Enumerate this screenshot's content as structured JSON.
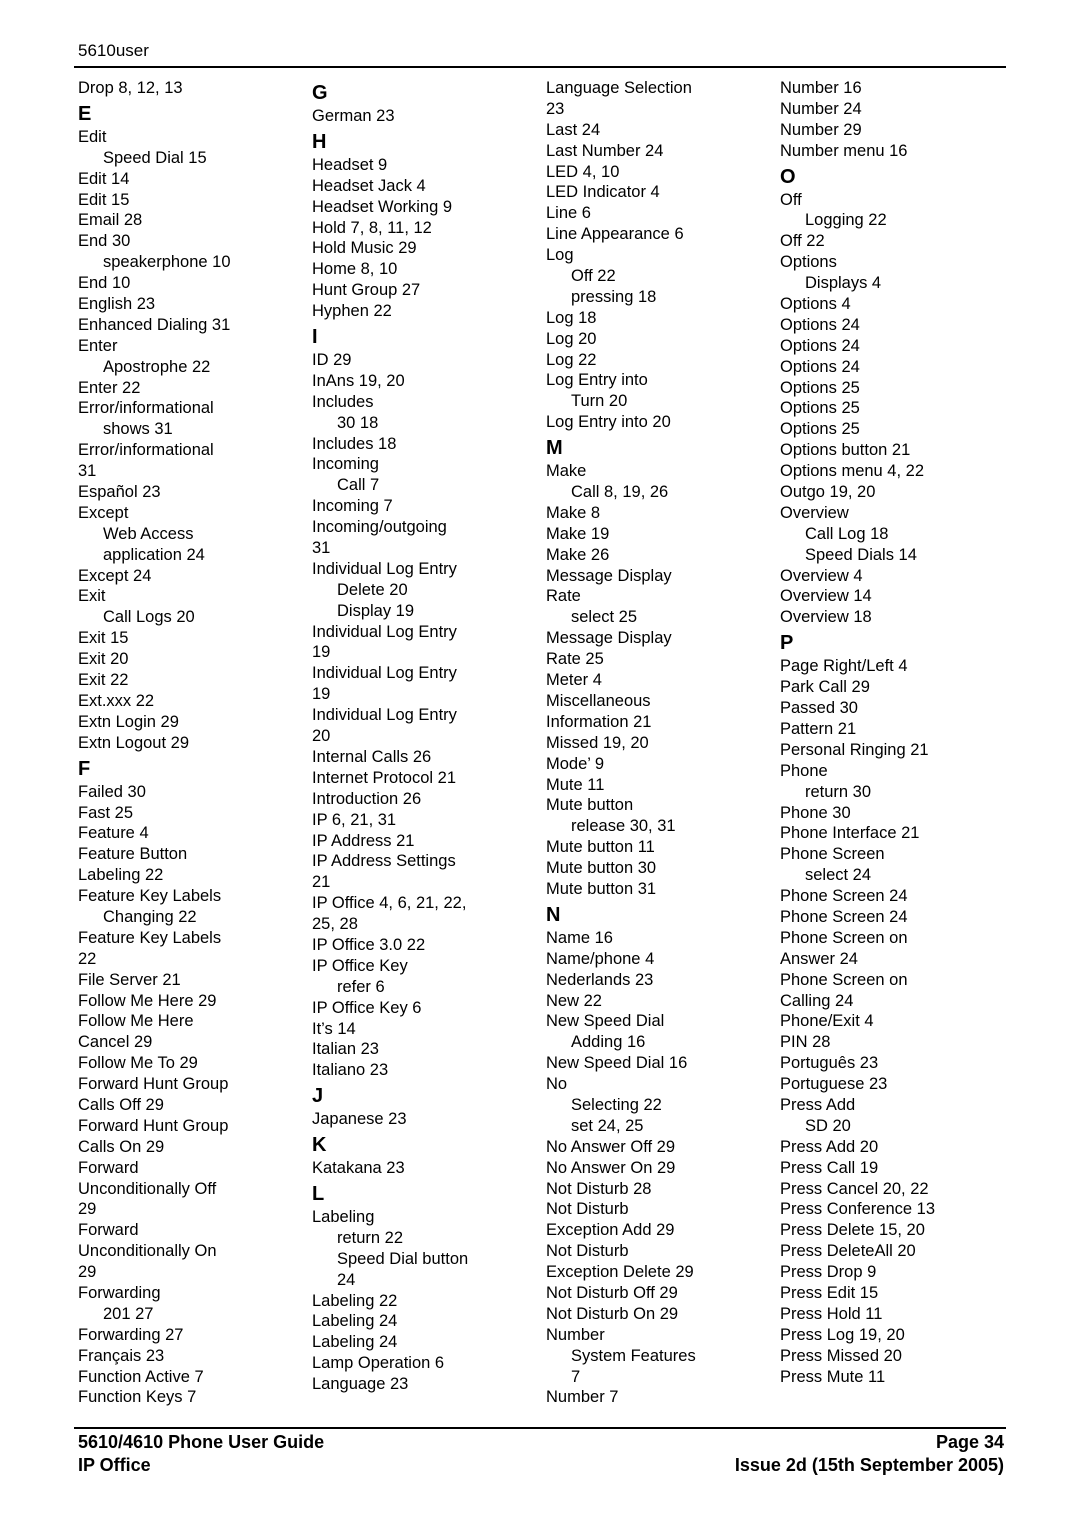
{
  "header": {
    "title": "5610user"
  },
  "columns": [
    [
      {
        "t": "Drop 8, 12, 13"
      },
      {
        "h": "E"
      },
      {
        "t": "Edit"
      },
      {
        "t": "Speed Dial 15",
        "s": 1
      },
      {
        "t": "Edit 14"
      },
      {
        "t": "Edit 15"
      },
      {
        "t": "Email 28"
      },
      {
        "t": "End 30"
      },
      {
        "t": "speakerphone 10",
        "s": 1
      },
      {
        "t": "End 10"
      },
      {
        "t": "English 23"
      },
      {
        "t": "Enhanced Dialing 31"
      },
      {
        "t": "Enter"
      },
      {
        "t": "Apostrophe 22",
        "s": 1
      },
      {
        "t": "Enter 22"
      },
      {
        "t": "Error/informational"
      },
      {
        "t": "shows 31",
        "s": 1
      },
      {
        "t": "Error/informational"
      },
      {
        "t": "31"
      },
      {
        "t": "Español 23"
      },
      {
        "t": "Except"
      },
      {
        "t": "Web Access",
        "s": 1
      },
      {
        "t": "application 24",
        "s": 1
      },
      {
        "t": "Except 24"
      },
      {
        "t": "Exit"
      },
      {
        "t": "Call Logs 20",
        "s": 1
      },
      {
        "t": "Exit 15"
      },
      {
        "t": "Exit 20"
      },
      {
        "t": "Exit 22"
      },
      {
        "t": "Ext.xxx 22"
      },
      {
        "t": "Extn Login 29"
      },
      {
        "t": "Extn Logout 29"
      },
      {
        "h": "F"
      },
      {
        "t": "Failed 30"
      },
      {
        "t": "Fast 25"
      },
      {
        "t": "Feature 4"
      },
      {
        "t": "Feature Button"
      },
      {
        "t": "Labeling 22"
      },
      {
        "t": "Feature Key Labels"
      },
      {
        "t": "Changing 22",
        "s": 1
      },
      {
        "t": "Feature Key Labels"
      },
      {
        "t": "22"
      },
      {
        "t": "File Server 21"
      },
      {
        "t": "Follow Me Here 29"
      },
      {
        "t": "Follow Me Here"
      },
      {
        "t": "Cancel 29"
      },
      {
        "t": "Follow Me To 29"
      },
      {
        "t": "Forward Hunt Group"
      },
      {
        "t": "Calls Off 29"
      },
      {
        "t": "Forward Hunt Group"
      },
      {
        "t": "Calls On 29"
      },
      {
        "t": "Forward"
      },
      {
        "t": "Unconditionally Off"
      },
      {
        "t": "29"
      },
      {
        "t": "Forward"
      },
      {
        "t": "Unconditionally On"
      },
      {
        "t": "29"
      },
      {
        "t": "Forwarding"
      },
      {
        "t": "201 27",
        "s": 1
      },
      {
        "t": "Forwarding 27"
      },
      {
        "t": "Français 23"
      },
      {
        "t": "Function Active 7"
      },
      {
        "t": "Function Keys 7"
      }
    ],
    [
      {
        "h": "G"
      },
      {
        "t": "German 23"
      },
      {
        "h": "H"
      },
      {
        "t": "Headset 9"
      },
      {
        "t": "Headset Jack 4"
      },
      {
        "t": "Headset Working 9"
      },
      {
        "t": "Hold 7, 8, 11, 12"
      },
      {
        "t": "Hold Music 29"
      },
      {
        "t": "Home 8, 10"
      },
      {
        "t": "Hunt Group 27"
      },
      {
        "t": "Hyphen 22"
      },
      {
        "h": "I"
      },
      {
        "t": "ID 29"
      },
      {
        "t": "InAns 19, 20"
      },
      {
        "t": "Includes"
      },
      {
        "t": "30 18",
        "s": 1
      },
      {
        "t": "Includes 18"
      },
      {
        "t": "Incoming"
      },
      {
        "t": "Call 7",
        "s": 1
      },
      {
        "t": "Incoming 7"
      },
      {
        "t": "Incoming/outgoing"
      },
      {
        "t": "31"
      },
      {
        "t": "Individual Log Entry"
      },
      {
        "t": "Delete 20",
        "s": 1
      },
      {
        "t": "Display 19",
        "s": 1
      },
      {
        "t": "Individual Log Entry"
      },
      {
        "t": "19"
      },
      {
        "t": "Individual Log Entry"
      },
      {
        "t": "19"
      },
      {
        "t": "Individual Log Entry"
      },
      {
        "t": "20"
      },
      {
        "t": "Internal Calls 26"
      },
      {
        "t": "Internet Protocol 21"
      },
      {
        "t": "Introduction 26"
      },
      {
        "t": "IP 6, 21, 31"
      },
      {
        "t": "IP Address 21"
      },
      {
        "t": "IP Address Settings"
      },
      {
        "t": "21"
      },
      {
        "t": "IP Office 4, 6, 21, 22,"
      },
      {
        "t": "25, 28"
      },
      {
        "t": "IP Office 3.0 22"
      },
      {
        "t": "IP Office Key"
      },
      {
        "t": "refer 6",
        "s": 1
      },
      {
        "t": "IP Office Key 6"
      },
      {
        "t": "It’s 14"
      },
      {
        "t": "Italian 23"
      },
      {
        "t": "Italiano 23"
      },
      {
        "h": "J"
      },
      {
        "t": "Japanese 23"
      },
      {
        "h": "K"
      },
      {
        "t": "Katakana 23"
      },
      {
        "h": "L"
      },
      {
        "t": "Labeling"
      },
      {
        "t": "return 22",
        "s": 1
      },
      {
        "t": "Speed Dial button",
        "s": 1
      },
      {
        "t": "24",
        "s": 1
      },
      {
        "t": "Labeling 22"
      },
      {
        "t": "Labeling 24"
      },
      {
        "t": "Labeling 24"
      },
      {
        "t": "Lamp Operation 6"
      },
      {
        "t": "Language 23"
      }
    ],
    [
      {
        "t": "Language Selection"
      },
      {
        "t": "23"
      },
      {
        "t": "Last 24"
      },
      {
        "t": "Last Number 24"
      },
      {
        "t": "LED 4, 10"
      },
      {
        "t": "LED Indicator 4"
      },
      {
        "t": "Line 6"
      },
      {
        "t": "Line Appearance 6"
      },
      {
        "t": "Log"
      },
      {
        "t": "Off 22",
        "s": 1
      },
      {
        "t": "pressing 18",
        "s": 1
      },
      {
        "t": "Log 18"
      },
      {
        "t": "Log 20"
      },
      {
        "t": "Log 22"
      },
      {
        "t": "Log Entry into"
      },
      {
        "t": "Turn 20",
        "s": 1
      },
      {
        "t": "Log Entry into 20"
      },
      {
        "h": "M"
      },
      {
        "t": "Make"
      },
      {
        "t": "Call 8, 19, 26",
        "s": 1
      },
      {
        "t": "Make 8"
      },
      {
        "t": "Make 19"
      },
      {
        "t": "Make 26"
      },
      {
        "t": "Message Display"
      },
      {
        "t": "Rate"
      },
      {
        "t": "select 25",
        "s": 1
      },
      {
        "t": "Message Display"
      },
      {
        "t": "Rate 25"
      },
      {
        "t": "Meter 4"
      },
      {
        "t": "Miscellaneous"
      },
      {
        "t": "Information 21"
      },
      {
        "t": "Missed 19, 20"
      },
      {
        "t": "Mode’ 9"
      },
      {
        "t": "Mute 11"
      },
      {
        "t": "Mute button"
      },
      {
        "t": "release 30, 31",
        "s": 1
      },
      {
        "t": "Mute button 11"
      },
      {
        "t": "Mute button 30"
      },
      {
        "t": "Mute button 31"
      },
      {
        "h": "N"
      },
      {
        "t": "Name 16"
      },
      {
        "t": "Name/phone 4"
      },
      {
        "t": "Nederlands 23"
      },
      {
        "t": "New 22"
      },
      {
        "t": "New Speed Dial"
      },
      {
        "t": "Adding 16",
        "s": 1
      },
      {
        "t": "New Speed Dial 16"
      },
      {
        "t": "No"
      },
      {
        "t": "Selecting 22",
        "s": 1
      },
      {
        "t": "set 24, 25",
        "s": 1
      },
      {
        "t": "No Answer Off 29"
      },
      {
        "t": "No Answer On 29"
      },
      {
        "t": "Not Disturb 28"
      },
      {
        "t": "Not Disturb"
      },
      {
        "t": "Exception Add 29"
      },
      {
        "t": "Not Disturb"
      },
      {
        "t": "Exception Delete 29"
      },
      {
        "t": "Not Disturb Off 29"
      },
      {
        "t": "Not Disturb On 29"
      },
      {
        "t": "Number"
      },
      {
        "t": "System Features",
        "s": 1
      },
      {
        "t": "7",
        "s": 1
      },
      {
        "t": "Number 7"
      }
    ],
    [
      {
        "t": "Number 16"
      },
      {
        "t": "Number 24"
      },
      {
        "t": "Number 29"
      },
      {
        "t": "Number menu 16"
      },
      {
        "h": "O"
      },
      {
        "t": "Off"
      },
      {
        "t": "Logging 22",
        "s": 1
      },
      {
        "t": "Off 22"
      },
      {
        "t": "Options"
      },
      {
        "t": "Displays 4",
        "s": 1
      },
      {
        "t": "Options 4"
      },
      {
        "t": "Options 24"
      },
      {
        "t": "Options 24"
      },
      {
        "t": "Options 24"
      },
      {
        "t": "Options 25"
      },
      {
        "t": "Options 25"
      },
      {
        "t": "Options 25"
      },
      {
        "t": "Options button 21"
      },
      {
        "t": "Options menu 4, 22"
      },
      {
        "t": "Outgo 19, 20"
      },
      {
        "t": "Overview"
      },
      {
        "t": "Call Log 18",
        "s": 1
      },
      {
        "t": "Speed Dials 14",
        "s": 1
      },
      {
        "t": "Overview 4"
      },
      {
        "t": "Overview 14"
      },
      {
        "t": "Overview 18"
      },
      {
        "h": "P"
      },
      {
        "t": "Page Right/Left 4"
      },
      {
        "t": "Park Call 29"
      },
      {
        "t": "Passed 30"
      },
      {
        "t": "Pattern 21"
      },
      {
        "t": "Personal Ringing 21"
      },
      {
        "t": "Phone"
      },
      {
        "t": "return 30",
        "s": 1
      },
      {
        "t": "Phone 30"
      },
      {
        "t": "Phone Interface 21"
      },
      {
        "t": "Phone Screen"
      },
      {
        "t": "select 24",
        "s": 1
      },
      {
        "t": "Phone Screen 24"
      },
      {
        "t": "Phone Screen 24"
      },
      {
        "t": "Phone Screen on"
      },
      {
        "t": "Answer 24"
      },
      {
        "t": "Phone Screen on"
      },
      {
        "t": "Calling 24"
      },
      {
        "t": "Phone/Exit 4"
      },
      {
        "t": "PIN 28"
      },
      {
        "t": "Português 23"
      },
      {
        "t": "Portuguese 23"
      },
      {
        "t": "Press Add"
      },
      {
        "t": "SD 20",
        "s": 1
      },
      {
        "t": "Press Add 20"
      },
      {
        "t": "Press Call 19"
      },
      {
        "t": "Press Cancel 20, 22"
      },
      {
        "t": "Press Conference 13"
      },
      {
        "t": "Press Delete 15, 20"
      },
      {
        "t": "Press DeleteAll 20"
      },
      {
        "t": "Press Drop 9"
      },
      {
        "t": "Press Edit 15"
      },
      {
        "t": "Press Hold 11"
      },
      {
        "t": "Press Log 19, 20"
      },
      {
        "t": "Press Missed 20"
      },
      {
        "t": "Press Mute 11"
      }
    ]
  ],
  "footer": {
    "guide_title": "5610/4610 Phone User Guide",
    "page_label": "Page 34",
    "product": "IP Office",
    "issue": "Issue 2d (15th September 2005)"
  }
}
